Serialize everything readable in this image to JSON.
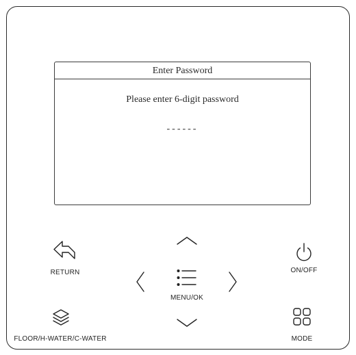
{
  "screen": {
    "title": "Enter Password",
    "prompt": "Please enter 6-digit password",
    "password_field": "------"
  },
  "buttons": {
    "return": {
      "label": "RETURN",
      "icon": "return-icon"
    },
    "on_off": {
      "label": "ON/OFF",
      "icon": "power-icon"
    },
    "menu_ok": {
      "label": "MENU/OK",
      "icon": "menu-icon"
    },
    "floor_water": {
      "label": "FLOOR/H-WATER/C-WATER",
      "icon": "layers-icon"
    },
    "mode": {
      "label": "MODE",
      "icon": "grid-icon"
    },
    "up": {
      "icon": "chevron-up-icon"
    },
    "down": {
      "icon": "chevron-down-icon"
    },
    "left": {
      "icon": "chevron-left-icon"
    },
    "right": {
      "icon": "chevron-right-icon"
    }
  }
}
